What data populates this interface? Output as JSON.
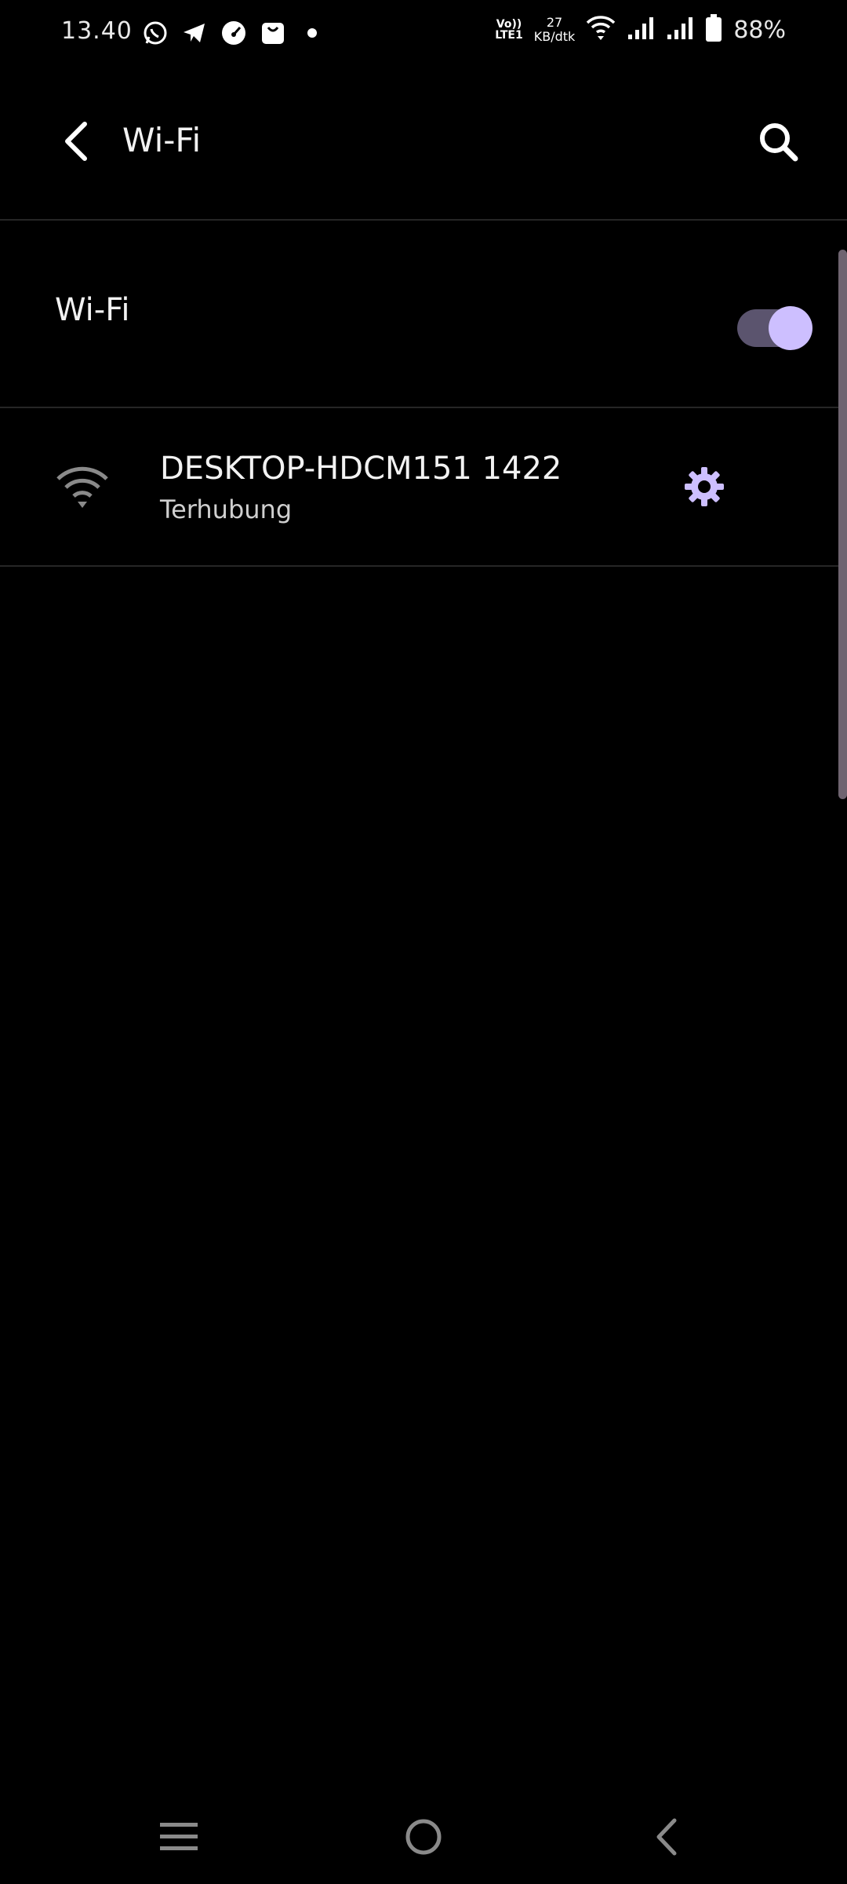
{
  "status_bar": {
    "time": "13.40",
    "volte_line1": "Vo))",
    "volte_line2": "LTE1",
    "net_speed_value": "27",
    "net_speed_unit": "KB/dtk",
    "battery": "88%"
  },
  "app_bar": {
    "title": "Wi-Fi"
  },
  "wifi_toggle": {
    "label": "Wi-Fi",
    "enabled": true
  },
  "network": {
    "name": "DESKTOP-HDCM151 1422",
    "status": "Terhubung"
  },
  "colors": {
    "background": "#000000",
    "accent": "#cdbfff",
    "toggle_track": "#5b546e",
    "divider": "#262626"
  }
}
